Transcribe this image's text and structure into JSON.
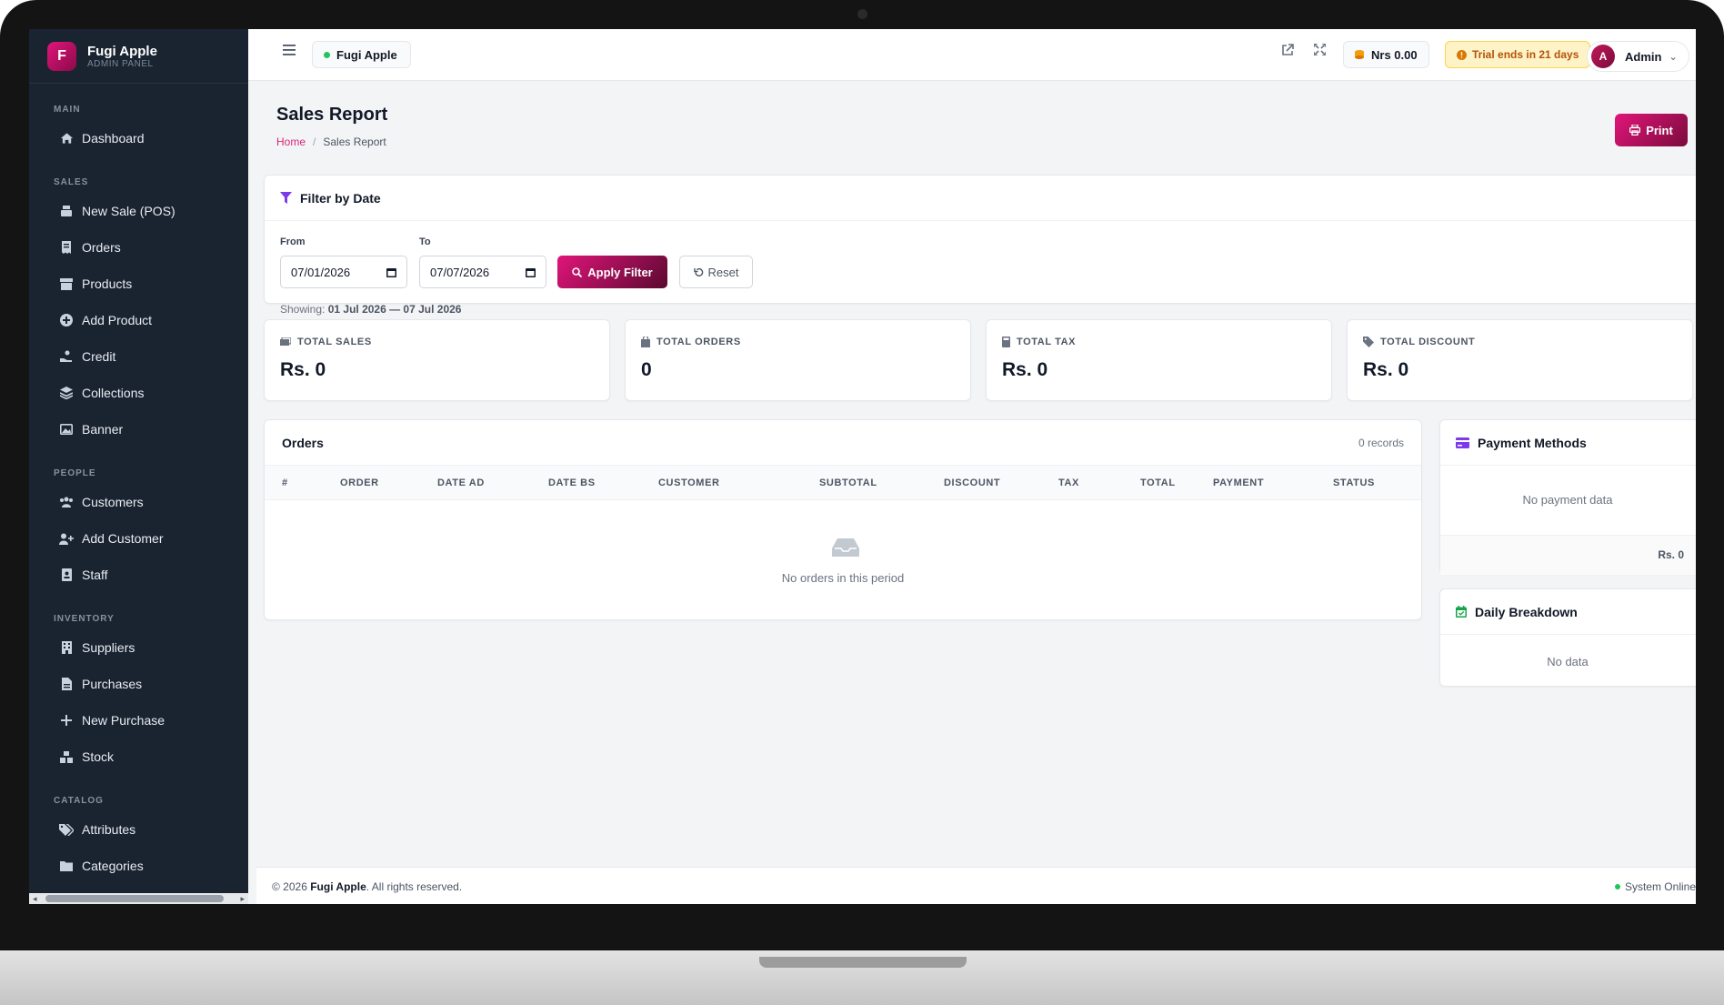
{
  "brand": {
    "logo_letter": "F",
    "name": "Fugi Apple",
    "subtitle": "ADMIN PANEL"
  },
  "sidebar": {
    "sections": [
      {
        "title": "MAIN",
        "items": [
          {
            "label": "Dashboard",
            "icon": "home-icon"
          }
        ]
      },
      {
        "title": "SALES",
        "items": [
          {
            "label": "New Sale (POS)",
            "icon": "cash-register-icon"
          },
          {
            "label": "Orders",
            "icon": "receipt-icon"
          },
          {
            "label": "Products",
            "icon": "box-icon"
          },
          {
            "label": "Add Product",
            "icon": "plus-circle-icon"
          },
          {
            "label": "Credit",
            "icon": "hand-coin-icon"
          },
          {
            "label": "Collections",
            "icon": "layers-icon"
          },
          {
            "label": "Banner",
            "icon": "image-icon"
          }
        ]
      },
      {
        "title": "PEOPLE",
        "items": [
          {
            "label": "Customers",
            "icon": "users-icon"
          },
          {
            "label": "Add Customer",
            "icon": "user-plus-icon"
          },
          {
            "label": "Staff",
            "icon": "id-badge-icon"
          }
        ]
      },
      {
        "title": "INVENTORY",
        "items": [
          {
            "label": "Suppliers",
            "icon": "building-icon"
          },
          {
            "label": "Purchases",
            "icon": "file-invoice-icon"
          },
          {
            "label": "New Purchase",
            "icon": "plus-icon"
          },
          {
            "label": "Stock",
            "icon": "boxes-icon"
          }
        ]
      },
      {
        "title": "CATALOG",
        "items": [
          {
            "label": "Attributes",
            "icon": "tags-icon"
          },
          {
            "label": "Categories",
            "icon": "folder-icon"
          }
        ]
      }
    ]
  },
  "topbar": {
    "store_name": "Fugi Apple",
    "wallet": "Nrs 0.00",
    "trial": "Trial ends in 21 days",
    "user_initial": "A",
    "user_name": "Admin"
  },
  "page": {
    "title": "Sales Report",
    "breadcrumb_home": "Home",
    "breadcrumb_current": "Sales Report",
    "print_label": "Print"
  },
  "filter": {
    "title": "Filter by Date",
    "from_label": "From",
    "from_value": "07/01/2026",
    "to_label": "To",
    "to_value": "07/07/2026",
    "apply_label": "Apply Filter",
    "reset_label": "Reset",
    "showing_prefix": "Showing:",
    "showing_range": "01 Jul 2026 — 07 Jul 2026"
  },
  "stats": [
    {
      "label": "TOTAL SALES",
      "value": "Rs. 0",
      "icon": "money-icon"
    },
    {
      "label": "TOTAL ORDERS",
      "value": "0",
      "icon": "bag-icon"
    },
    {
      "label": "TOTAL TAX",
      "value": "Rs. 0",
      "icon": "calculator-icon"
    },
    {
      "label": "TOTAL DISCOUNT",
      "value": "Rs. 0",
      "icon": "tag-icon"
    }
  ],
  "orders": {
    "title": "Orders",
    "count": "0 records",
    "columns": [
      "#",
      "ORDER",
      "DATE AD",
      "DATE BS",
      "CUSTOMER",
      "SUBTOTAL",
      "DISCOUNT",
      "TAX",
      "TOTAL",
      "PAYMENT",
      "STATUS"
    ],
    "empty": "No orders in this period"
  },
  "payment_methods": {
    "title": "Payment Methods",
    "empty": "No payment data",
    "total": "Rs. 0"
  },
  "daily_breakdown": {
    "title": "Daily Breakdown",
    "empty": "No data"
  },
  "footer": {
    "prefix": "© 2026",
    "brand": "Fugi Apple",
    "suffix": ". All rights reserved.",
    "status": "System Online"
  },
  "colors": {
    "accent": "#db2777",
    "sidebar_bg": "#1a2431",
    "success": "#22c55e",
    "trial_bg": "#fef3c7",
    "trial_text": "#b45309"
  }
}
